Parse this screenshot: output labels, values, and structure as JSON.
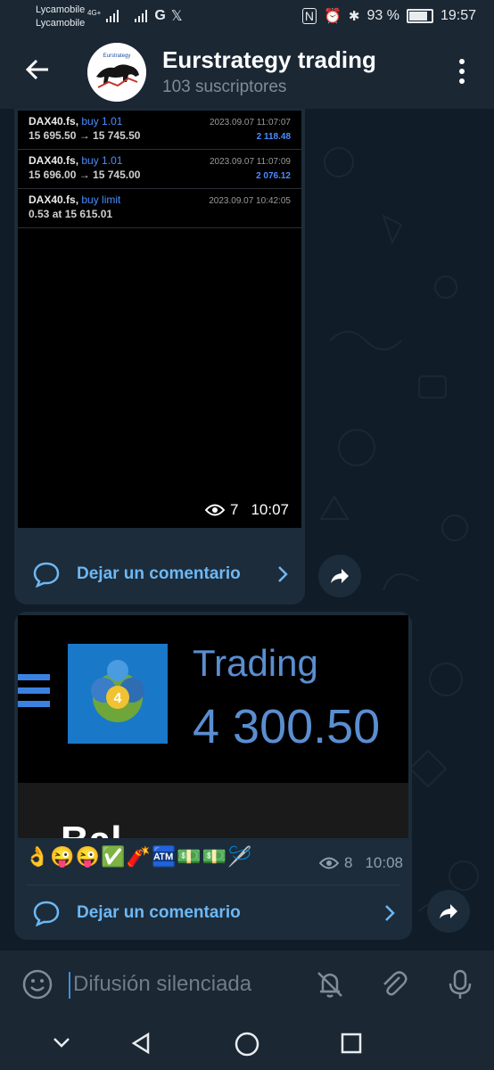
{
  "status_bar": {
    "carrier_1": "Lycamobile",
    "carrier_2": "Lycamobile",
    "network": "4G+",
    "battery": "93 %",
    "battery_level": 0.93,
    "time": "19:57"
  },
  "header": {
    "title": "Eurstrategy trading",
    "subtitle": "103 suscriptores"
  },
  "messages": [
    {
      "trades": [
        {
          "symbol": "DAX40.fs,",
          "action": "buy 1.01",
          "price": "15 695.50 → 15 745.50",
          "date": "2023.09.07 11:07:07",
          "profit": "2 118.48"
        },
        {
          "symbol": "DAX40.fs,",
          "action": "buy 1.01",
          "price": "15 696.00 → 15 745.00",
          "date": "2023.09.07 11:07:09",
          "profit": "2 076.12"
        },
        {
          "symbol": "DAX40.fs,",
          "action": "buy limit",
          "price": "0.53 at 15 615.01",
          "date": "2023.09.07 10:42:05",
          "profit": ""
        }
      ],
      "views": "7",
      "time": "10:07",
      "comment_label": "Dejar un comentario"
    },
    {
      "image_title": "Trading",
      "image_value": "4 300.50",
      "image_partial": "Bal",
      "emojis": "👌😜😜✅🧨🏧💵💵🪡",
      "views": "8",
      "time": "10:08",
      "comment_label": "Dejar un comentario"
    }
  ],
  "input": {
    "placeholder": "Difusión silenciada"
  },
  "colors": {
    "accent": "#6db8f5",
    "bubble": "#1c2c3a",
    "bar": "#1b2733",
    "link_blue": "#4a8cff"
  }
}
